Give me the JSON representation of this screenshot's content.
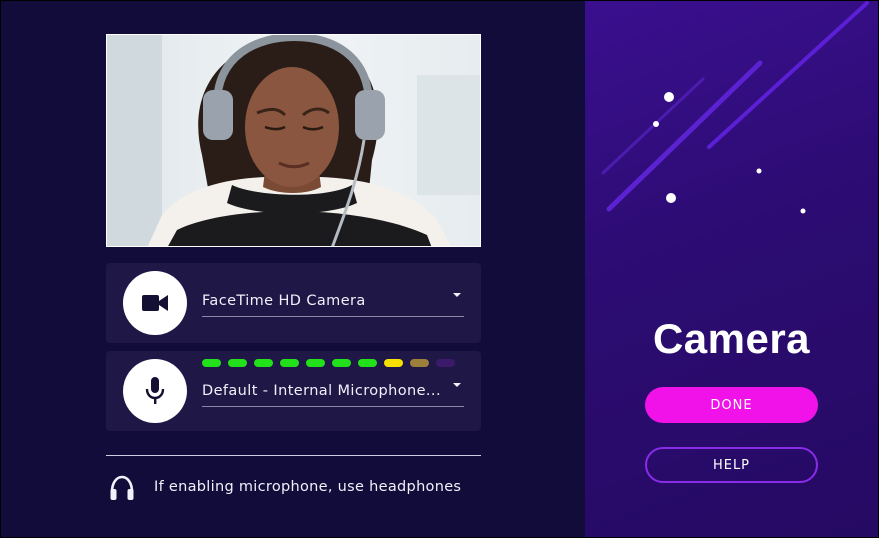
{
  "camera_select": {
    "value": "FaceTime HD Camera"
  },
  "mic_select": {
    "value": "Default - Internal Microphone..."
  },
  "mic_level": {
    "segments": [
      {
        "color": "#22e11a"
      },
      {
        "color": "#22e11a"
      },
      {
        "color": "#22e11a"
      },
      {
        "color": "#22e11a"
      },
      {
        "color": "#22e11a"
      },
      {
        "color": "#22e11a"
      },
      {
        "color": "#22e11a"
      },
      {
        "color": "#f5e000"
      },
      {
        "color": "#9c7f3a"
      },
      {
        "color": "#3c1a6a"
      }
    ]
  },
  "tip": {
    "text": "If enabling microphone, use headphones"
  },
  "panel": {
    "title": "Camera",
    "done_label": "DONE",
    "help_label": "HELP"
  },
  "colors": {
    "background": "#120c3a",
    "row_background": "#1f1847",
    "panel_gradient_start": "#3a0f8f",
    "done_button": "#f012e8",
    "help_border": "#8a2be8"
  },
  "icons": {
    "camera": "video-camera-icon",
    "microphone": "microphone-icon",
    "headphones": "headphones-icon"
  }
}
